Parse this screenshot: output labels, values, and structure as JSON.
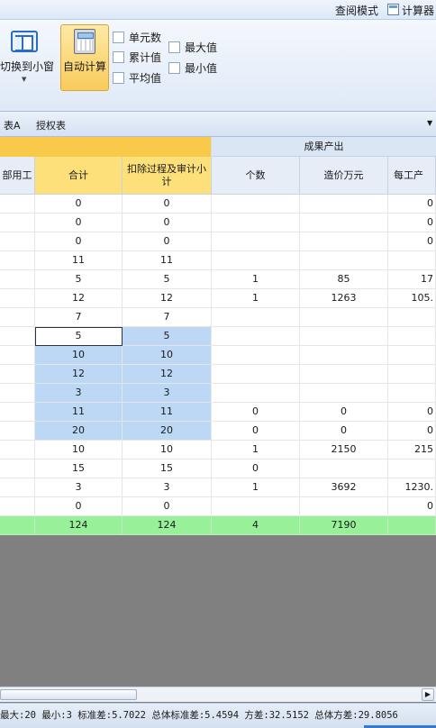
{
  "topbar": {
    "read_mode": "查阅模式",
    "calculator": "计算器",
    "calculator_icon": "calculator-icon"
  },
  "ribbon": {
    "switch_window": "切换到小窗",
    "auto_calc": "自动计算",
    "checkboxes": {
      "cell_count": "单元数",
      "sum": "累计值",
      "average": "平均值",
      "max": "最大值",
      "min": "最小值"
    },
    "active_color": "#f9cc5a"
  },
  "tabs": {
    "table_a": "表A",
    "auth_table": "授权表"
  },
  "grid": {
    "group_header": "成果产出",
    "headers": [
      "部用工",
      "合计",
      "扣除过程及审计小计",
      "个数",
      "造价万元",
      "每工产"
    ],
    "rows": [
      [
        "",
        "0",
        "0",
        "",
        "",
        "0"
      ],
      [
        "",
        "0",
        "0",
        "",
        "",
        "0"
      ],
      [
        "",
        "0",
        "0",
        "",
        "",
        "0"
      ],
      [
        "",
        "11",
        "11",
        "",
        "",
        ""
      ],
      [
        "",
        "5",
        "5",
        "1",
        "85",
        "17"
      ],
      [
        "",
        "12",
        "12",
        "1",
        "1263",
        "105."
      ],
      [
        "",
        "7",
        "7",
        "",
        "",
        ""
      ],
      [
        "",
        "5",
        "5",
        "",
        "",
        ""
      ],
      [
        "",
        "10",
        "10",
        "",
        "",
        ""
      ],
      [
        "",
        "12",
        "12",
        "",
        "",
        ""
      ],
      [
        "",
        "3",
        "3",
        "",
        "",
        ""
      ],
      [
        "",
        "11",
        "11",
        "0",
        "0",
        "0"
      ],
      [
        "",
        "20",
        "20",
        "0",
        "0",
        "0"
      ],
      [
        "",
        "10",
        "10",
        "1",
        "2150",
        "215"
      ],
      [
        "",
        "15",
        "15",
        "0",
        "",
        ""
      ],
      [
        "",
        "3",
        "3",
        "1",
        "3692",
        "1230."
      ],
      [
        "",
        "0",
        "0",
        "",
        "",
        "0"
      ]
    ],
    "total": [
      "",
      "124",
      "124",
      "4",
      "7190",
      ""
    ],
    "selection_color": "#bcd8f5",
    "total_color": "#98f198"
  },
  "status": {
    "text": "最大:20 最小:3 标准差:5.7022 总体标准差:5.4594 方差:32.5152 总体方差:29.8056"
  }
}
